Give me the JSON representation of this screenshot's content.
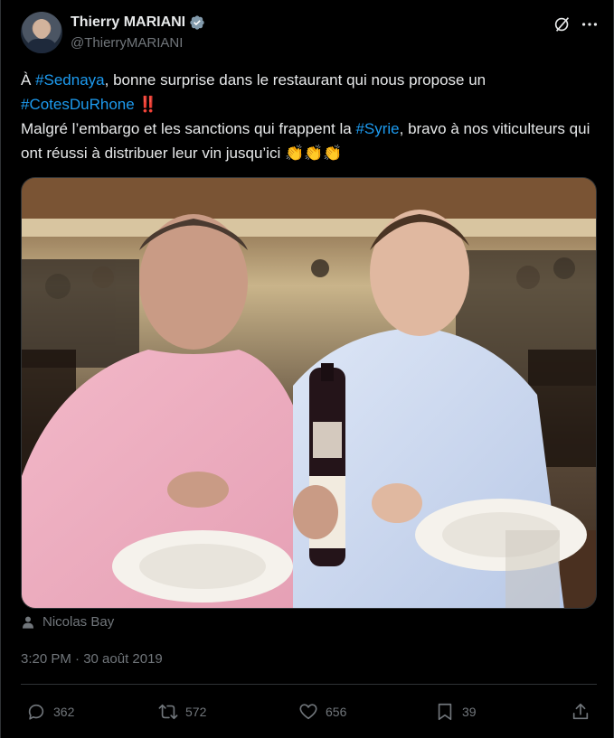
{
  "author": {
    "display_name": "Thierry MARIANI",
    "handle": "@ThierryMARIANI",
    "verified": true
  },
  "tweet": {
    "segments": [
      {
        "text": "À ",
        "type": "text"
      },
      {
        "text": "#Sednaya",
        "type": "hashtag"
      },
      {
        "text": ", bonne surprise dans le restaurant qui nous propose un ",
        "type": "text"
      },
      {
        "text": "#CotesDuRhone",
        "type": "hashtag"
      },
      {
        "text": " ‼️",
        "type": "text"
      },
      {
        "text": "\n",
        "type": "break"
      },
      {
        "text": "Malgré l’embargo et les sanctions  qui frappent la ",
        "type": "text"
      },
      {
        "text": "#Syrie",
        "type": "hashtag"
      },
      {
        "text": ", bravo à nos viticulteurs qui ont réussi à distribuer leur vin jusqu’ici ",
        "type": "text"
      },
      {
        "text": "👏👏👏",
        "type": "emoji"
      }
    ],
    "tagged_user": "Nicolas Bay",
    "timestamp": "3:20 PM · 30 août 2019"
  },
  "stats": {
    "replies": "362",
    "retweets": "572",
    "likes": "656",
    "bookmarks": "39"
  },
  "colors": {
    "background": "#000000",
    "text": "#e7e9ea",
    "muted": "#71767b",
    "link": "#1d9bf0",
    "border": "#2f3336"
  },
  "icons": [
    "verified-badge-icon",
    "grok-icon",
    "more-icon",
    "person-icon",
    "reply-icon",
    "retweet-icon",
    "like-icon",
    "bookmark-icon",
    "share-icon"
  ]
}
